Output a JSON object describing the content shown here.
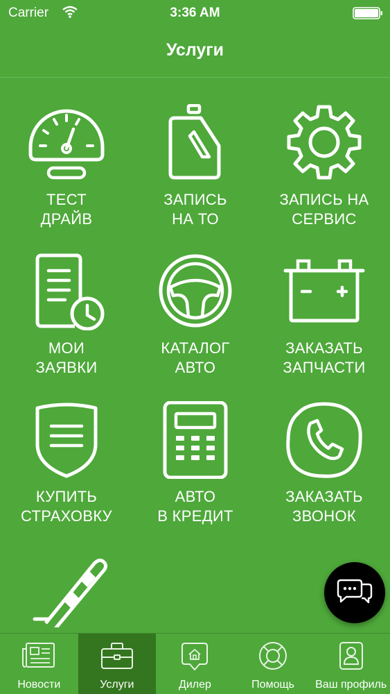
{
  "status_bar": {
    "carrier": "Carrier",
    "time": "3:36 AM"
  },
  "header": {
    "title": "Услуги"
  },
  "services": [
    {
      "label": "ТЕСТ\nДРАЙВ",
      "icon": "speedometer-icon"
    },
    {
      "label": "ЗАПИСЬ\nНА ТО",
      "icon": "oil-canister-icon"
    },
    {
      "label": "ЗАПИСЬ НА\nСЕРВИС",
      "icon": "gear-icon"
    },
    {
      "label": "МОИ\nЗАЯВКИ",
      "icon": "document-clock-icon"
    },
    {
      "label": "КАТАЛОГ\nАВТО",
      "icon": "steering-wheel-icon"
    },
    {
      "label": "ЗАКАЗАТЬ\nЗАПЧАСТИ",
      "icon": "battery-icon"
    },
    {
      "label": "КУПИТЬ\nСТРАХОВКУ",
      "icon": "shield-document-icon"
    },
    {
      "label": "АВТО\nВ КРЕДИТ",
      "icon": "calculator-icon"
    },
    {
      "label": "ЗАКАЗАТЬ\nЗВОНОК",
      "icon": "phone-icon"
    },
    {
      "label": "",
      "icon": "barrier-pole-icon"
    }
  ],
  "chat_button": {
    "icon": "chat-bubbles-icon"
  },
  "tabs": [
    {
      "label": "Новости",
      "icon": "newspaper-icon",
      "active": false
    },
    {
      "label": "Услуги",
      "icon": "briefcase-icon",
      "active": true
    },
    {
      "label": "Дилер",
      "icon": "location-pin-icon",
      "active": false
    },
    {
      "label": "Помощь",
      "icon": "lifebuoy-icon",
      "active": false
    },
    {
      "label": "Ваш профиль",
      "icon": "profile-icon",
      "active": false
    }
  ],
  "colors": {
    "background": "#4ea83a",
    "active_tab": "#34761f",
    "foreground": "#ffffff"
  }
}
